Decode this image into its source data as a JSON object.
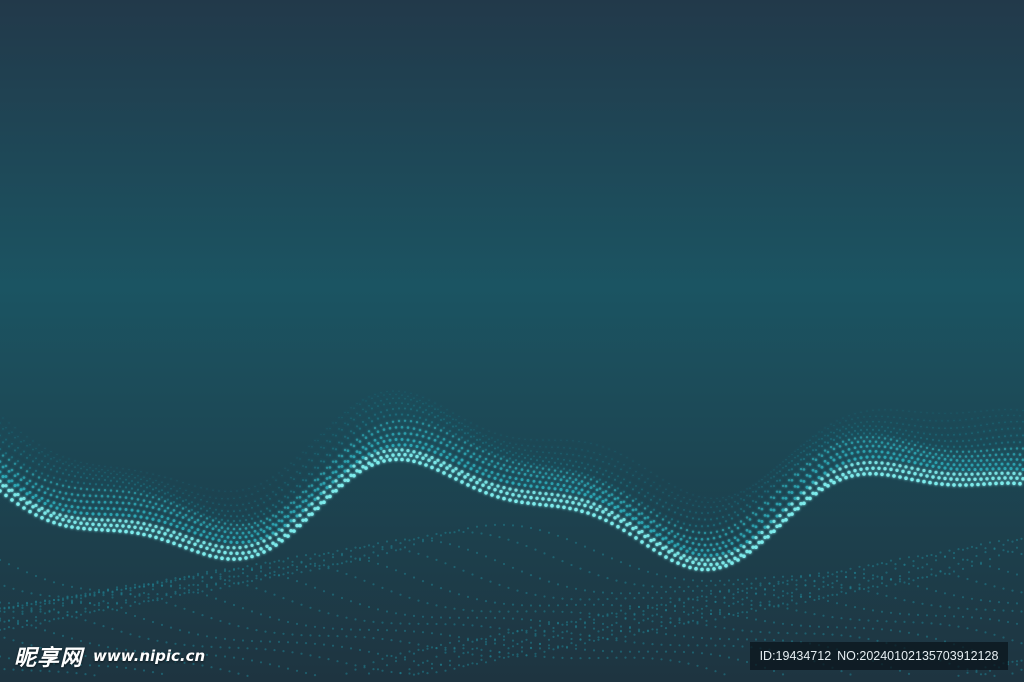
{
  "colors": {
    "sky_top": "#22394a",
    "sky_mid": "#1b5462",
    "sky_bottom": "#1e3440",
    "dot_bright": "#7ff0f0",
    "dot_mid": "#2fb5c2",
    "dot_dim": "#1f7f90"
  },
  "watermark": {
    "logo_text": "昵享网",
    "url_text": "www.nipic.cn"
  },
  "image_info": {
    "id_text": "ID:19434712",
    "no_text": "NO:20240102135703912128"
  }
}
